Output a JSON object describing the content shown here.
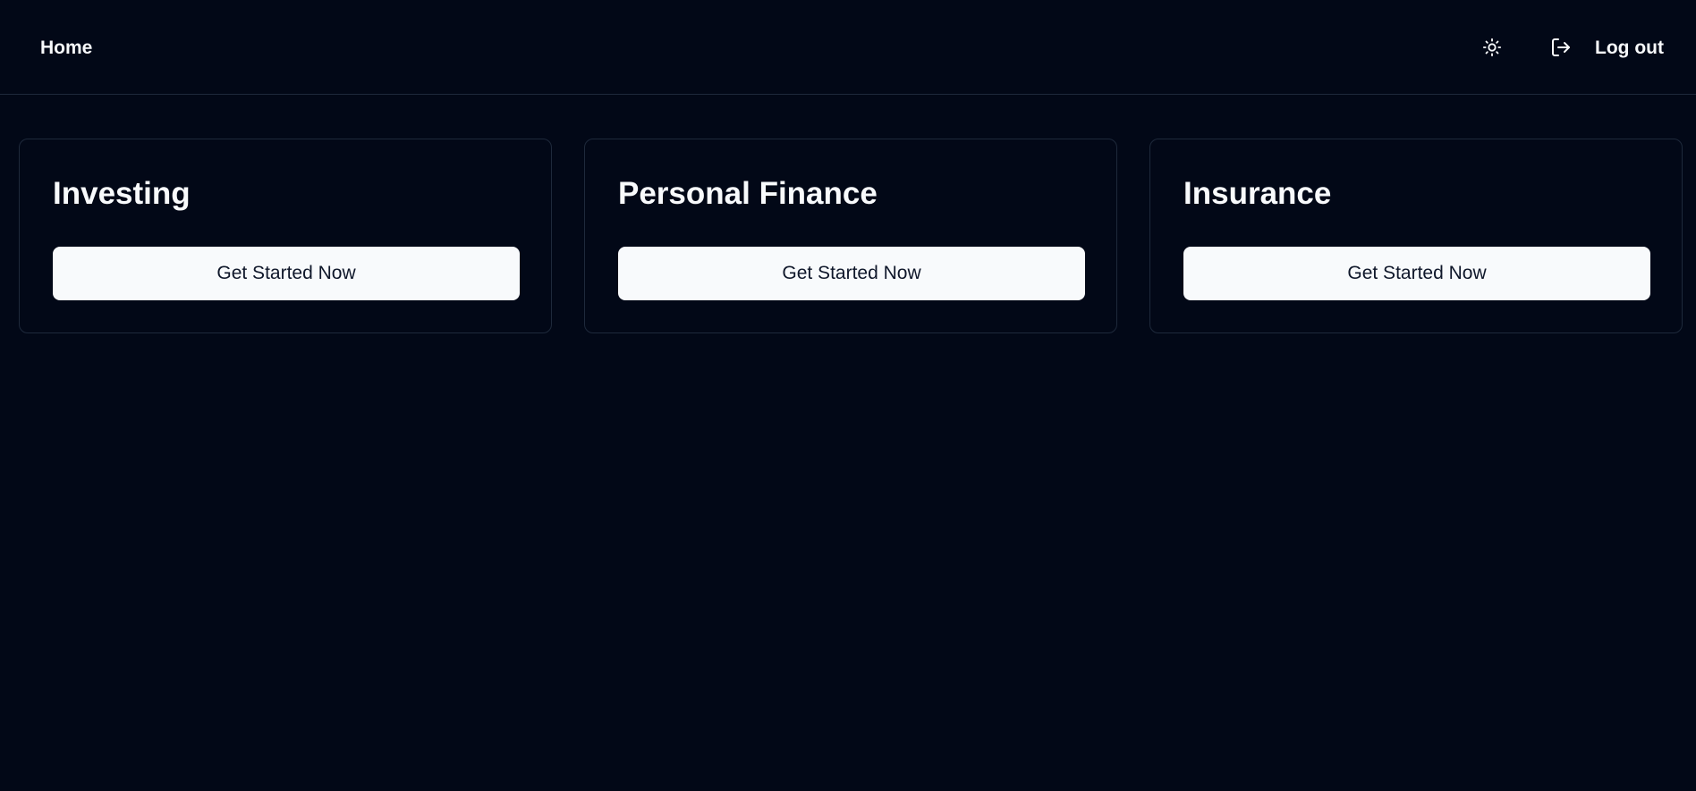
{
  "header": {
    "home_label": "Home",
    "theme_toggle_icon": "sun-icon",
    "logout_icon": "log-out-icon",
    "logout_label": "Log out"
  },
  "cards": [
    {
      "title": "Investing",
      "button_label": "Get Started Now"
    },
    {
      "title": "Personal Finance",
      "button_label": "Get Started Now"
    },
    {
      "title": "Insurance",
      "button_label": "Get Started Now"
    }
  ],
  "colors": {
    "background": "#020817",
    "border": "#1e293b",
    "text": "#f8fafc",
    "button_background": "#f8fafc",
    "button_text": "#0f172a"
  }
}
